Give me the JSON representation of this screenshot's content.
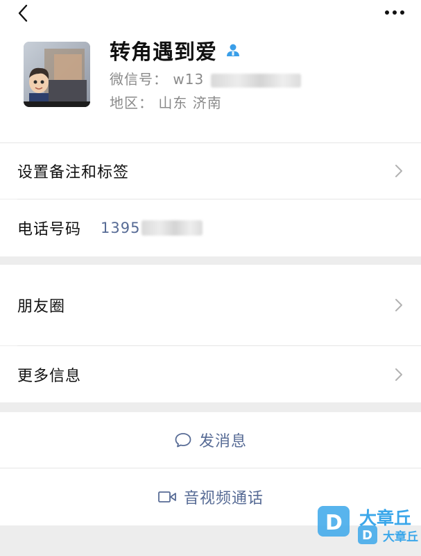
{
  "nav": {
    "back_icon": "chevron-left-icon",
    "more_icon": "more-dots-icon"
  },
  "profile": {
    "nickname": "转角遇到爱",
    "wechat_label": "微信号：",
    "wechat_id_visible": "w13",
    "region_label": "地区：",
    "region_value": "山东 济南",
    "contact_icon": "contact-person-icon"
  },
  "rows": {
    "remark_label": "设置备注和标签",
    "phone_label": "电话号码",
    "phone_value_visible": "1395",
    "moments_label": "朋友圈",
    "more_info_label": "更多信息"
  },
  "actions": {
    "message_label": "发消息",
    "message_icon": "chat-bubble-icon",
    "call_label": "音视频通话",
    "call_icon": "video-camera-icon"
  },
  "watermark": {
    "text": "大章丘"
  },
  "colors": {
    "link_blue": "#576b95",
    "background": "#ededed",
    "watermark_blue": "#3ba7ea"
  }
}
